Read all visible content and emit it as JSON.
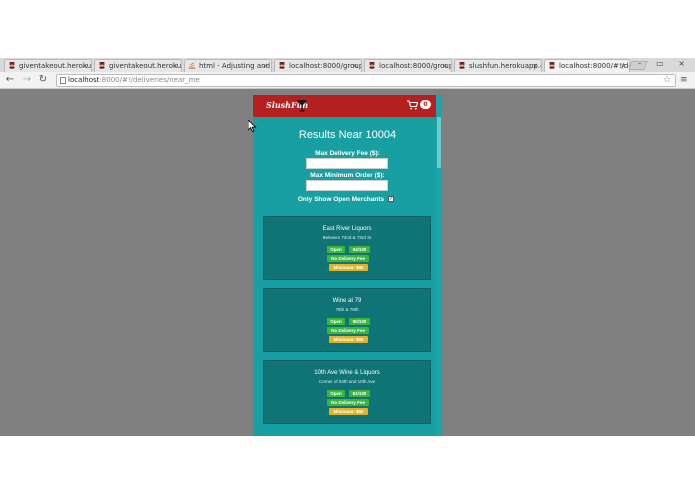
{
  "browser": {
    "tabs": [
      {
        "label": "giventakeout.herokuap",
        "active": false
      },
      {
        "label": "giventakeout.herokuap",
        "active": false
      },
      {
        "label": "html - Adjusting and in",
        "active": false
      },
      {
        "label": "localhost:8000/group_",
        "active": false
      },
      {
        "label": "localhost:8000/group_",
        "active": false
      },
      {
        "label": "slushfun.herokuapp.co",
        "active": false
      },
      {
        "label": "localhost:8000/#!/deli",
        "active": true
      }
    ],
    "close_glyph": "×",
    "window_buttons": "– ▭ ×",
    "url_host": "localhost",
    "url_path": ":8000/#!/deliveries/near_me",
    "back_glyph": "←",
    "forward_glyph": "→",
    "reload_glyph": "↻",
    "star_glyph": "☆",
    "menu_glyph": "≡"
  },
  "app": {
    "brand": "SlushFun",
    "cart_count": "0",
    "results_title": "Results Near 10004",
    "max_delivery_fee_label": "Max Delivery Fee ($):",
    "max_min_order_label": "Max Minimum Order ($):",
    "open_only_label": "Only Show Open Merchants",
    "open_only_checked": "✓"
  },
  "merchants": [
    {
      "name": "East River Liquors",
      "address": "Between 72nd & 73rd St",
      "status": "Open",
      "score": "94/100",
      "fee": "No Delivery Fee",
      "minimum": "Minimum: $60"
    },
    {
      "name": "Wine at 79",
      "address": "78th & 79th",
      "status": "Open",
      "score": "90/100",
      "fee": "No Delivery Fee",
      "minimum": "Minimum: $60"
    },
    {
      "name": "10th Ave Wine & Liquors",
      "address": "Corner of 54th and 10th Ave",
      "status": "Open",
      "score": "81/100",
      "fee": "No Delivery Fee",
      "minimum": "Minimum: $50"
    }
  ],
  "colors": {
    "header_red": "#b3201f",
    "teal": "#179fa1",
    "card_teal": "#107376",
    "badge_green": "#3bb53b",
    "badge_yellow": "#e1b428"
  }
}
